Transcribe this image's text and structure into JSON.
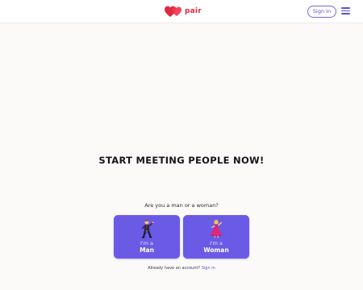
{
  "header": {
    "logo_text": "pair",
    "signin_label": "Sign in",
    "menu_icon": "hamburger-menu-icon"
  },
  "hero": {
    "title": "START MEETING PEOPLE NOW!"
  },
  "gender_select": {
    "question": "Are you a man or a woman?",
    "options": [
      {
        "prefix": "I'm a",
        "label": "Man",
        "icon": "man-dancing-icon"
      },
      {
        "prefix": "I'm a",
        "label": "Woman",
        "icon": "woman-dancing-icon"
      }
    ]
  },
  "footer": {
    "account_prompt": "Already have an account?",
    "signin_link": "Sign in"
  },
  "colors": {
    "brand_red": "#e0283f",
    "accent_purple": "#6b5ae6",
    "link_purple": "#5b4fd8",
    "background": "#fbfaf8"
  }
}
